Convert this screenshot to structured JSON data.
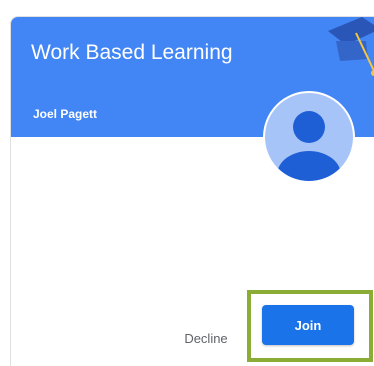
{
  "card": {
    "title": "Work Based Learning",
    "teacher": "Joel Pagett",
    "header_color": "#4285f4",
    "header_art_icon": "graduation-cap-icon",
    "avatar_icon": "person-icon",
    "avatar_color": "#a7c4f9"
  },
  "actions": {
    "decline_label": "Decline",
    "join_label": "Join",
    "join_color": "#1a73e8",
    "highlight_color": "#8bad35"
  }
}
